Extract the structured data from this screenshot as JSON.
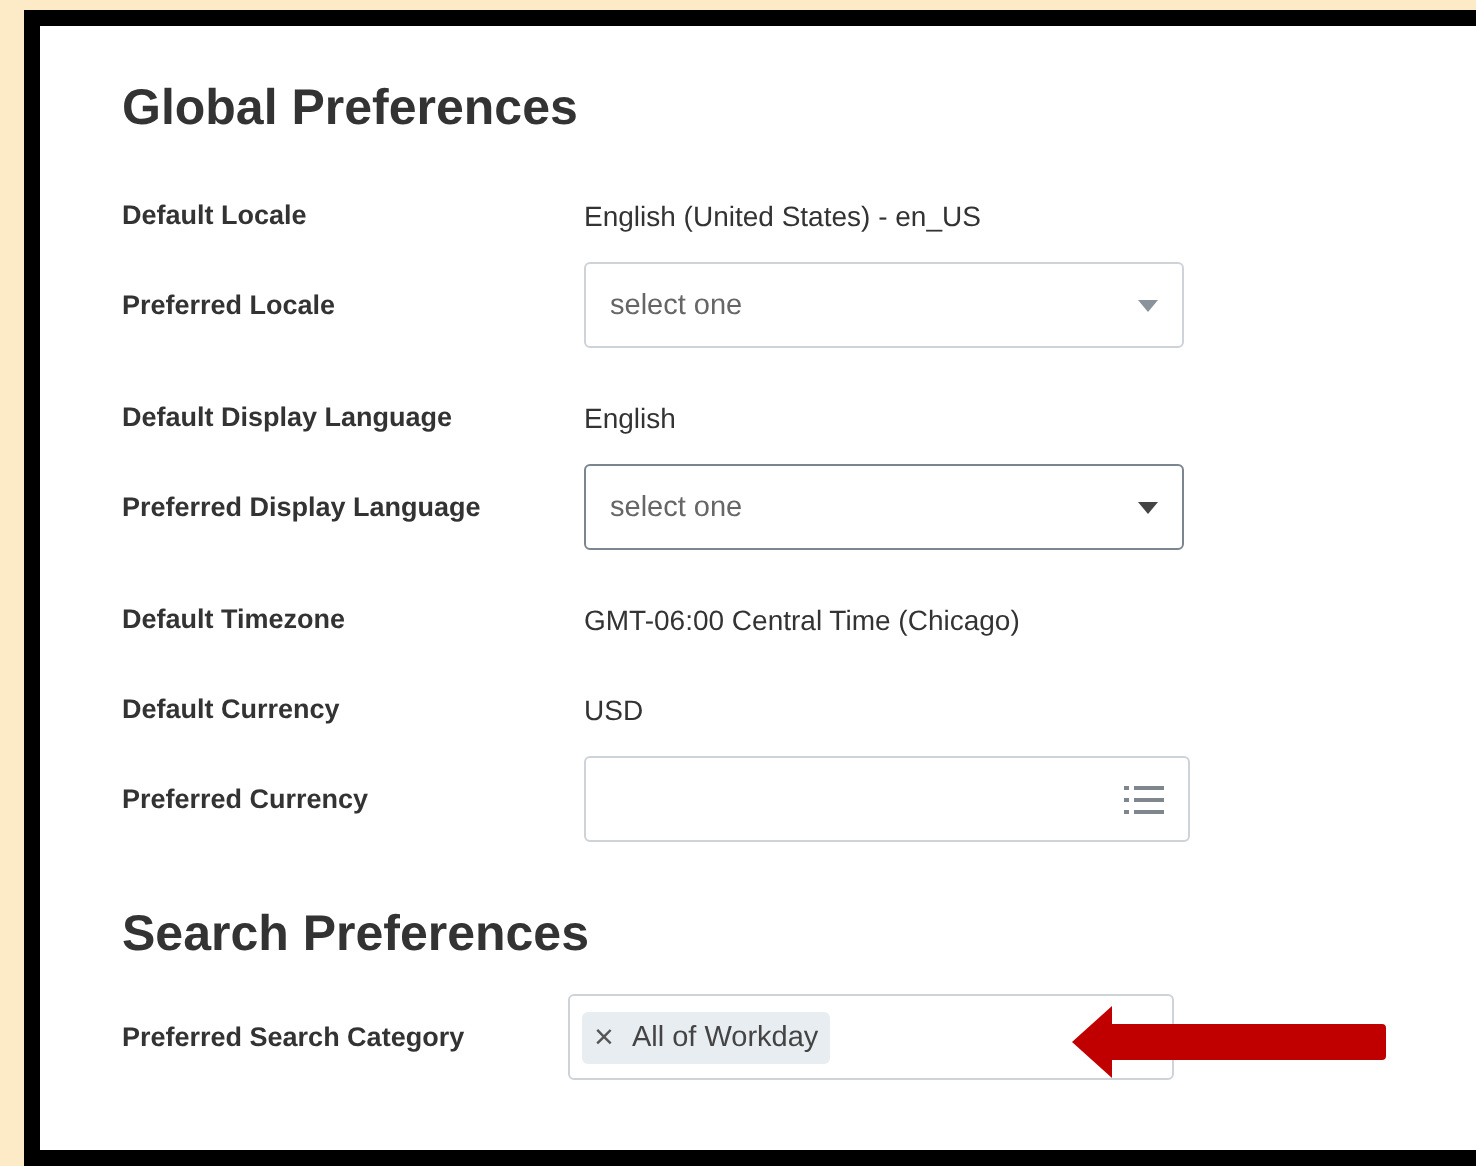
{
  "sections": [
    {
      "title": "Global Preferences",
      "rows": [
        {
          "label": "Default Locale",
          "kind": "text",
          "value": "English (United States) - en_US"
        },
        {
          "label": "Preferred Locale",
          "kind": "select",
          "placeholder": "select one",
          "focused": false
        },
        {
          "label": "Default Display Language",
          "kind": "text",
          "value": "English"
        },
        {
          "label": "Preferred Display Language",
          "kind": "select",
          "placeholder": "select one",
          "focused": true
        },
        {
          "label": "Default Timezone",
          "kind": "text",
          "value": "GMT-06:00 Central Time (Chicago)"
        },
        {
          "label": "Default Currency",
          "kind": "text",
          "value": "USD"
        },
        {
          "label": "Preferred Currency",
          "kind": "prompt"
        }
      ]
    },
    {
      "title": "Search Preferences",
      "rows": [
        {
          "label": "Preferred Search Category",
          "kind": "multiselect",
          "chips": [
            {
              "remove": "×",
              "label": "All of Workday"
            }
          ]
        }
      ]
    }
  ]
}
